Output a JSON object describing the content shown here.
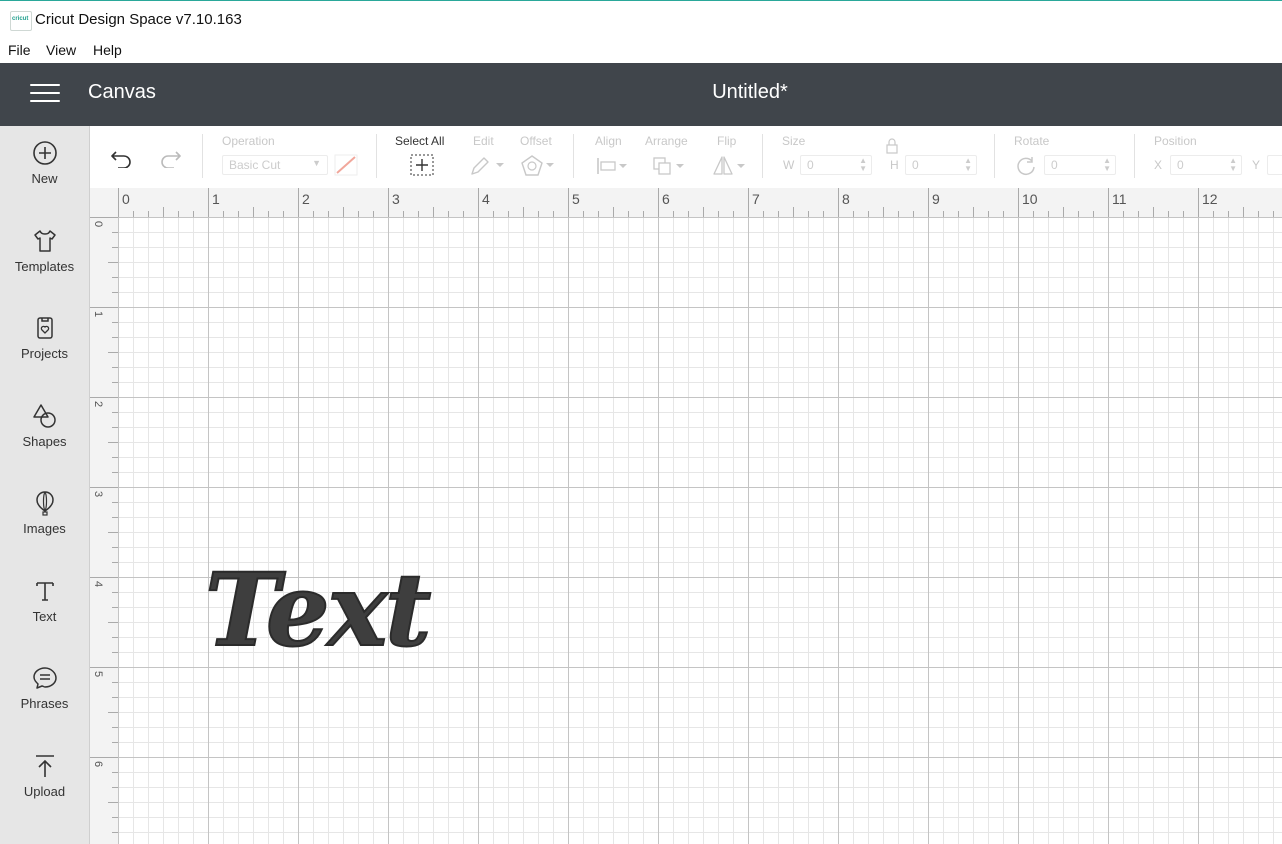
{
  "window": {
    "logo_text": "cricut",
    "title": "Cricut Design Space  v7.10.163"
  },
  "menu": [
    "File",
    "View",
    "Help"
  ],
  "header": {
    "section": "Canvas",
    "document_title": "Untitled*"
  },
  "sidebar": {
    "items": [
      {
        "label": "New",
        "icon": "plus-circle-icon"
      },
      {
        "label": "Templates",
        "icon": "shirt-icon"
      },
      {
        "label": "Projects",
        "icon": "projects-icon"
      },
      {
        "label": "Shapes",
        "icon": "shapes-icon"
      },
      {
        "label": "Images",
        "icon": "balloon-icon"
      },
      {
        "label": "Text",
        "icon": "text-icon"
      },
      {
        "label": "Phrases",
        "icon": "speech-bubble-icon"
      },
      {
        "label": "Upload",
        "icon": "upload-icon"
      }
    ]
  },
  "toolbar": {
    "operation_label": "Operation",
    "operation_value": "Basic Cut",
    "select_all_label": "Select All",
    "edit_label": "Edit",
    "offset_label": "Offset",
    "align_label": "Align",
    "arrange_label": "Arrange",
    "flip_label": "Flip",
    "size_label": "Size",
    "w_label": "W",
    "w_value": "0",
    "h_label": "H",
    "h_value": "0",
    "rotate_label": "Rotate",
    "rotate_value": "0",
    "position_label": "Position",
    "x_label": "X",
    "x_value": "0",
    "y_label": "Y"
  },
  "ruler": {
    "horizontal": [
      "0",
      "1",
      "2",
      "3",
      "4",
      "5",
      "6",
      "7",
      "8",
      "9",
      "10",
      "11",
      "12"
    ],
    "vertical": [
      "0",
      "1",
      "2",
      "3",
      "4",
      "5",
      "6"
    ]
  },
  "canvas": {
    "text_object": "Text"
  },
  "colors": {
    "header_bg": "#40454b",
    "sidebar_bg": "#e6e6e6",
    "accent": "#2aa89a",
    "operation_swatch": "#f1a79b"
  }
}
